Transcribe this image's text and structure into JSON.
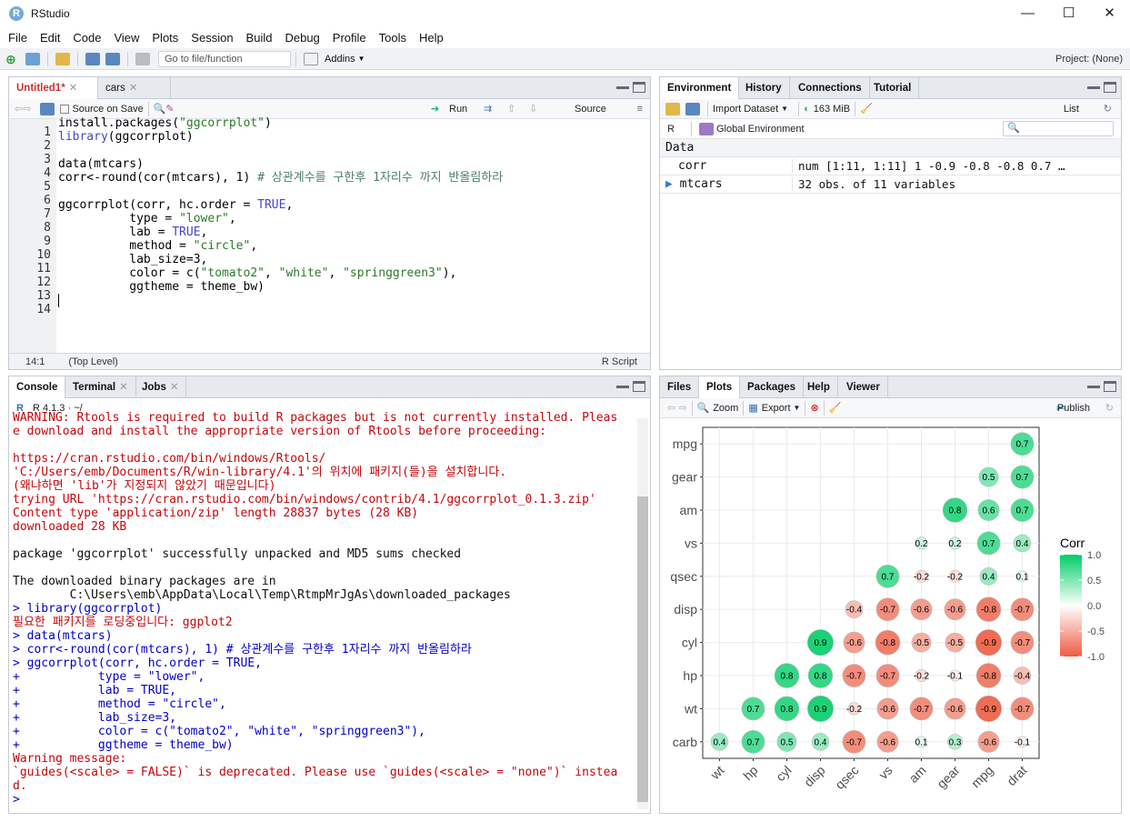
{
  "window": {
    "title": "RStudio",
    "min": "—",
    "max": "☐",
    "close": "✕"
  },
  "menu": [
    "File",
    "Edit",
    "Code",
    "View",
    "Plots",
    "Session",
    "Build",
    "Debug",
    "Profile",
    "Tools",
    "Help"
  ],
  "toolbar": {
    "goto_placeholder": "Go to file/function",
    "addins": "Addins",
    "project": "Project: (None)"
  },
  "editor": {
    "tabs": [
      {
        "label": "Untitled1*",
        "active": true
      },
      {
        "label": "cars",
        "active": false
      }
    ],
    "source_on_save": "Source on Save",
    "run": "Run",
    "source": "Source",
    "lines": [
      "1",
      "2",
      "3",
      "4",
      "5",
      "6",
      "7",
      "8",
      "9",
      "10",
      "11",
      "12",
      "13",
      "14"
    ],
    "status_pos": "14:1",
    "status_scope": "(Top Level)",
    "status_type": "R Script"
  },
  "env": {
    "tabs": [
      "Environment",
      "History",
      "Connections",
      "Tutorial"
    ],
    "import": "Import Dataset",
    "memory": "163 MiB",
    "view": "List",
    "r": "R",
    "scope": "Global Environment",
    "section": "Data",
    "rows": [
      {
        "name": "corr",
        "value": "num [1:11, 1:11] 1 -0.9 -0.8 -0.8 0.7 …"
      },
      {
        "name": "mtcars",
        "value": "32 obs. of 11 variables"
      }
    ]
  },
  "console": {
    "tabs": [
      "Console",
      "Terminal",
      "Jobs"
    ],
    "rversion": "R 4.1.3 · ~/",
    "lines": [
      {
        "c": "red",
        "t": "WARNING: Rtools is required to build R packages but is not currently installed. Pleas"
      },
      {
        "c": "red",
        "t": "e download and install the appropriate version of Rtools before proceeding:"
      },
      {
        "c": "red",
        "t": ""
      },
      {
        "c": "red",
        "t": "https://cran.rstudio.com/bin/windows/Rtools/"
      },
      {
        "c": "red",
        "t": "'C:/Users/emb/Documents/R/win-library/4.1'의 위치에 패키지(들)을 설치합니다."
      },
      {
        "c": "red",
        "t": "(왜냐하면 'lib'가 지정되지 않았기 때문입니다)"
      },
      {
        "c": "red",
        "t": "trying URL 'https://cran.rstudio.com/bin/windows/contrib/4.1/ggcorrplot_0.1.3.zip'"
      },
      {
        "c": "red",
        "t": "Content type 'application/zip' length 28837 bytes (28 KB)"
      },
      {
        "c": "red",
        "t": "downloaded 28 KB"
      },
      {
        "c": "",
        "t": ""
      },
      {
        "c": "",
        "t": "package 'ggcorrplot' successfully unpacked and MD5 sums checked"
      },
      {
        "c": "",
        "t": ""
      },
      {
        "c": "",
        "t": "The downloaded binary packages are in"
      },
      {
        "c": "",
        "t": "        C:\\Users\\emb\\AppData\\Local\\Temp\\RtmpMrJgAs\\downloaded_packages"
      },
      {
        "c": "blue",
        "t": "> library(ggcorrplot)"
      },
      {
        "c": "red",
        "t": "필요한 패키지를 로딩중입니다: ggplot2"
      },
      {
        "c": "blue",
        "t": "> data(mtcars)"
      },
      {
        "c": "blue",
        "t": "> corr<-round(cor(mtcars), 1) # 상관계수를 구한후 1자리수 까지 반올림하라"
      },
      {
        "c": "blue",
        "t": "> ggcorrplot(corr, hc.order = TRUE,"
      },
      {
        "c": "blue",
        "t": "+           type = \"lower\","
      },
      {
        "c": "blue",
        "t": "+           lab = TRUE,"
      },
      {
        "c": "blue",
        "t": "+           method = \"circle\","
      },
      {
        "c": "blue",
        "t": "+           lab_size=3,"
      },
      {
        "c": "blue",
        "t": "+           color = c(\"tomato2\", \"white\", \"springgreen3\"),"
      },
      {
        "c": "blue",
        "t": "+           ggtheme = theme_bw)"
      },
      {
        "c": "red",
        "t": "Warning message:"
      },
      {
        "c": "red",
        "t": "`guides(<scale> = FALSE)` is deprecated. Please use `guides(<scale> = \"none\")` instea"
      },
      {
        "c": "red",
        "t": "d."
      },
      {
        "c": "blue",
        "t": "> "
      }
    ]
  },
  "files": {
    "tabs": [
      "Files",
      "Plots",
      "Packages",
      "Help",
      "Viewer"
    ],
    "zoom": "Zoom",
    "export": "Export",
    "publish": "Publish"
  },
  "chart_data": {
    "type": "heatmap",
    "title": "",
    "y_labels": [
      "mpg",
      "gear",
      "am",
      "vs",
      "qsec",
      "disp",
      "cyl",
      "hp",
      "wt",
      "carb"
    ],
    "x_labels": [
      "wt",
      "hp",
      "cyl",
      "disp",
      "qsec",
      "vs",
      "am",
      "gear",
      "mpg",
      "drat"
    ],
    "cells": [
      [
        null,
        null,
        null,
        null,
        null,
        null,
        null,
        null,
        null,
        0.7
      ],
      [
        null,
        null,
        null,
        null,
        null,
        null,
        null,
        null,
        0.5,
        0.7
      ],
      [
        null,
        null,
        null,
        null,
        null,
        null,
        null,
        0.8,
        0.6,
        0.7
      ],
      [
        null,
        null,
        null,
        null,
        null,
        null,
        0.2,
        0.2,
        0.7,
        0.4
      ],
      [
        null,
        null,
        null,
        null,
        null,
        0.7,
        -0.2,
        -0.2,
        0.4,
        0.1
      ],
      [
        null,
        null,
        null,
        null,
        -0.4,
        -0.7,
        -0.6,
        -0.6,
        -0.8,
        -0.7
      ],
      [
        null,
        null,
        null,
        0.9,
        -0.6,
        -0.8,
        -0.5,
        -0.5,
        -0.9,
        -0.7
      ],
      [
        null,
        null,
        0.8,
        0.8,
        -0.7,
        -0.7,
        -0.2,
        -0.1,
        -0.8,
        -0.4
      ],
      [
        null,
        0.7,
        0.8,
        0.9,
        -0.2,
        -0.6,
        -0.7,
        -0.6,
        -0.9,
        -0.7
      ],
      [
        0.4,
        0.7,
        0.5,
        0.4,
        -0.7,
        -0.6,
        0.1,
        0.3,
        -0.6,
        -0.1
      ]
    ],
    "legend": {
      "title": "Corr",
      "ticks": [
        "1.0",
        "0.5",
        "0.0",
        "-0.5",
        "-1.0"
      ]
    },
    "colors": {
      "low": "#EE5C42",
      "mid": "#FFFFFF",
      "high": "#00CD66"
    }
  }
}
